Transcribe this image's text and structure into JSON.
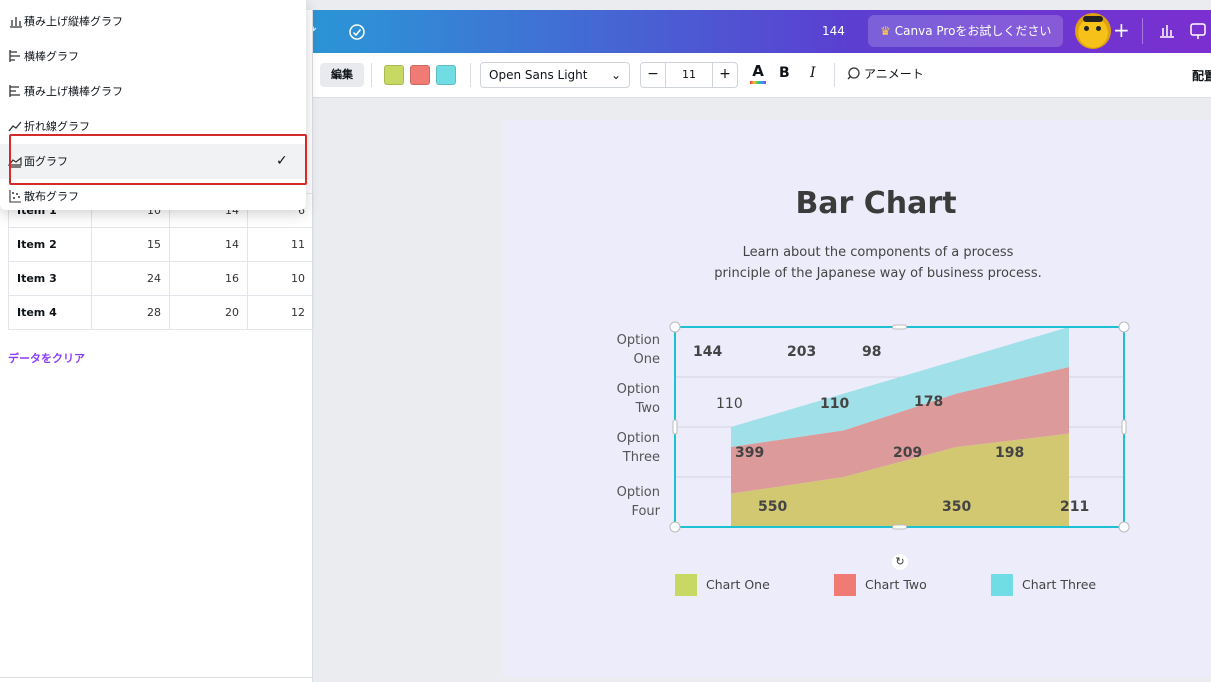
{
  "topbar": {
    "count": "144",
    "pro_label": "Canva Proをお試しください"
  },
  "toolbar": {
    "edit_label": "編集",
    "swatches": [
      "#c8d963",
      "#f07b74",
      "#6fdde3"
    ],
    "font_name": "Open Sans Light",
    "font_size": "11",
    "bold_label": "B",
    "italic_label": "I",
    "color_label": "A",
    "animate_label": "アニメート",
    "position_label": "配置"
  },
  "chart_type_menu": {
    "items": [
      {
        "label": "積み上げ縦棒グラフ",
        "icon": "stacked-column-icon",
        "selected": false
      },
      {
        "label": "横棒グラフ",
        "icon": "horizontal-bar-icon",
        "selected": false
      },
      {
        "label": "積み上げ横棒グラフ",
        "icon": "stacked-horizontal-bar-icon",
        "selected": false
      },
      {
        "label": "折れ線グラフ",
        "icon": "line-chart-icon",
        "selected": false
      },
      {
        "label": "面グラフ",
        "icon": "area-chart-icon",
        "selected": true
      },
      {
        "label": "散布グラフ",
        "icon": "scatter-chart-icon",
        "selected": false
      }
    ]
  },
  "data_table": {
    "rows": [
      {
        "name": "Item 1",
        "values": [
          "10",
          "14",
          "6"
        ]
      },
      {
        "name": "Item 2",
        "values": [
          "15",
          "14",
          "11"
        ]
      },
      {
        "name": "Item 3",
        "values": [
          "24",
          "16",
          "10"
        ]
      },
      {
        "name": "Item 4",
        "values": [
          "28",
          "20",
          "12"
        ]
      }
    ],
    "clear_label": "データをクリア"
  },
  "design": {
    "title": "Bar Chart",
    "subtitle_line1": "Learn about the components of a process",
    "subtitle_line2": "principle of the Japanese way of business process."
  },
  "chart_data": {
    "type": "area",
    "stacked": true,
    "categories": [
      "Item 1",
      "Item 2",
      "Item 3",
      "Item 4"
    ],
    "series": [
      {
        "name": "Chart One",
        "color": "#d2c872",
        "values": [
          10,
          15,
          24,
          28
        ]
      },
      {
        "name": "Chart Two",
        "color": "#dd9a9a",
        "values": [
          14,
          14,
          16,
          20
        ]
      },
      {
        "name": "Chart Three",
        "color": "#9fe0e9",
        "values": [
          6,
          11,
          10,
          12
        ]
      }
    ],
    "y_tick_labels": [
      [
        "Option",
        "One"
      ],
      [
        "Option",
        "Two"
      ],
      [
        "Option",
        "Three"
      ],
      [
        "Option",
        "Four"
      ]
    ],
    "annotations": [
      "144",
      "203",
      "98",
      "110",
      "110",
      "178",
      "399",
      "209",
      "198",
      "550",
      "350",
      "211"
    ],
    "ylim": [
      0,
      60
    ],
    "grid": true,
    "legend_position": "bottom"
  }
}
